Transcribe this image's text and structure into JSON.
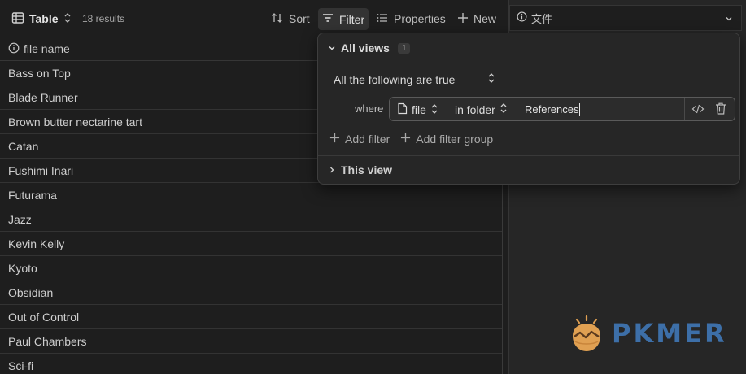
{
  "toolbar": {
    "view_label": "Table",
    "results_label": "18 results",
    "sort_label": "Sort",
    "filter_label": "Filter",
    "properties_label": "Properties",
    "new_label": "New"
  },
  "table": {
    "column_header": "file name",
    "rows": [
      "Bass on Top",
      "Blade Runner",
      "Brown butter nectarine tart",
      "Catan",
      "Fushimi Inari",
      "Futurama",
      "Jazz",
      "Kevin Kelly",
      "Kyoto",
      "Obsidian",
      "Out of Control",
      "Paul Chambers",
      "Sci-fi"
    ]
  },
  "right_pane": {
    "property_label": "文件"
  },
  "filter_popover": {
    "all_views_label": "All views",
    "all_views_count": "1",
    "condition_label": "All the following are true",
    "where_label": "where",
    "filter_property": "file",
    "filter_operator": "in folder",
    "filter_value": "References",
    "add_filter_label": "Add filter",
    "add_filter_group_label": "Add filter group",
    "this_view_label": "This view"
  },
  "watermark": {
    "text": "PKMER"
  },
  "colors": {
    "background": "#1e1e1e",
    "popover_bg": "#262626",
    "watermark_blue": "#3d6fa8",
    "watermark_orange": "#e0a052"
  }
}
